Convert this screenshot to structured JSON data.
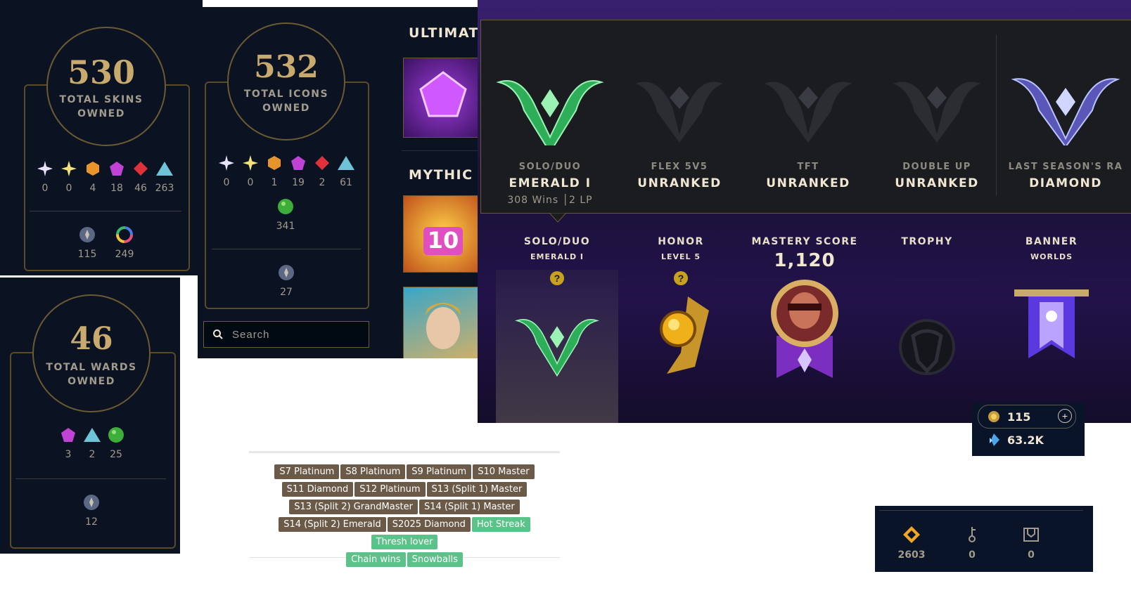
{
  "skins": {
    "total": "530",
    "caption1": "TOTAL SKINS",
    "caption2": "OWNED",
    "gem_counts": [
      "0",
      "0",
      "4",
      "18",
      "46",
      "263"
    ],
    "extra_counts": [
      "115",
      "249"
    ]
  },
  "icons": {
    "total": "532",
    "caption1": "TOTAL ICONS",
    "caption2": "OWNED",
    "gem_counts": [
      "0",
      "0",
      "1",
      "19",
      "2",
      "61"
    ],
    "green_count": "341",
    "extra_count": "27",
    "search_placeholder": "Search"
  },
  "store": {
    "section1": "ULTIMAT",
    "section2": "MYTHIC"
  },
  "wards": {
    "total": "46",
    "caption1": "TOTAL WARDS",
    "caption2": "OWNED",
    "gem_counts": [
      "3",
      "2",
      "25"
    ],
    "extra_count": "12"
  },
  "ranks": [
    {
      "queue": "SOLO/DUO",
      "tier": "EMERALD I",
      "wins": "308 Wins",
      "lp": "2 LP"
    },
    {
      "queue": "FLEX 5V5",
      "tier": "UNRANKED"
    },
    {
      "queue": "TFT",
      "tier": "UNRANKED"
    },
    {
      "queue": "DOUBLE UP",
      "tier": "UNRANKED"
    },
    {
      "queue": "LAST SEASON'S RA",
      "tier": "DIAMOND"
    }
  ],
  "profile": {
    "solo": {
      "title": "SOLO/DUO",
      "sub": "EMERALD I"
    },
    "honor": {
      "title": "HONOR",
      "sub": "LEVEL 5"
    },
    "mastery": {
      "title": "MASTERY SCORE",
      "value": "1,120"
    },
    "trophy": {
      "title": "TROPHY"
    },
    "banner": {
      "title": "BANNER",
      "sub": "WORLDS"
    }
  },
  "currency": {
    "rp": "115",
    "be": "63.2K"
  },
  "loot": {
    "orange": "2603",
    "keys": "0",
    "chests": "0"
  },
  "tags": {
    "row1": [
      "S7 Platinum",
      "S8 Platinum",
      "S9 Platinum",
      "S10 Master"
    ],
    "row2": [
      "S11 Diamond",
      "S12 Platinum",
      "S13 (Split 1) Master"
    ],
    "row3": [
      "S13 (Split 2) GrandMaster",
      "S14 (Split 1) Master"
    ],
    "row4": [
      "S14 (Split 2) Emerald",
      "S2025 Diamond",
      "Hot Streak",
      "Thresh lover"
    ],
    "row5": [
      "Chain wins",
      "Snowballs"
    ]
  },
  "colors": {
    "panel_bg": "#0b1222",
    "gold": "#c8aa6e",
    "emerald": "#2fae5a",
    "tag_brown": "#6b5a48",
    "tag_green": "#5bc38a"
  }
}
